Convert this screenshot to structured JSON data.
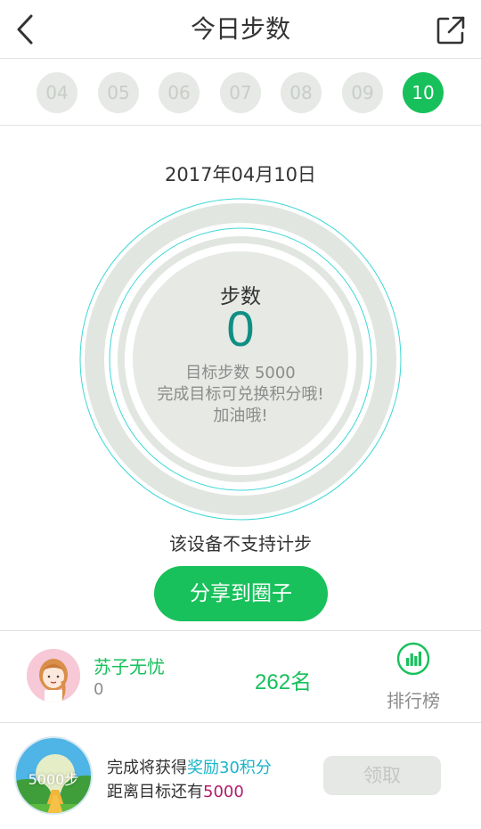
{
  "header": {
    "title": "今日步数",
    "back_icon": "chevron-left-icon",
    "share_icon": "external-share-icon"
  },
  "date_tabs": [
    {
      "label": "04",
      "active": false
    },
    {
      "label": "05",
      "active": false
    },
    {
      "label": "06",
      "active": false
    },
    {
      "label": "07",
      "active": false
    },
    {
      "label": "08",
      "active": false
    },
    {
      "label": "09",
      "active": false
    },
    {
      "label": "10",
      "active": true
    }
  ],
  "summary": {
    "date": "2017年04月10日",
    "steps_label": "步数",
    "steps_value": "0",
    "goal_line": "目标步数 5000",
    "hint_line": "完成目标可兑换积分哦!",
    "cheer_line": "加油哦!",
    "progress_fraction": 0
  },
  "status": {
    "unsupported": "该设备不支持计步"
  },
  "share_button": {
    "label": "分享到圈子"
  },
  "ranking": {
    "user_name": "苏子无忧",
    "user_steps": "0",
    "rank_number": "262",
    "rank_suffix": "名",
    "leaderboard_label": "排行榜",
    "leaderboard_icon": "bar-chart-icon"
  },
  "reward": {
    "badge_text": "5000步",
    "line1_prefix": "完成将获得",
    "line1_highlight": "奖励30积分",
    "line2_prefix": "距离目标还有",
    "line2_highlight": "5000",
    "claim_label": "领取",
    "claim_enabled": false
  },
  "colors": {
    "accent_green": "#17c05b",
    "steps_teal": "#0f8f84",
    "ring_gray": "#e2e6e1",
    "ring_outline_cyan": "#3ed6d6",
    "highlight_cyan": "#1ab5c8",
    "highlight_magenta": "#b21d6b"
  }
}
